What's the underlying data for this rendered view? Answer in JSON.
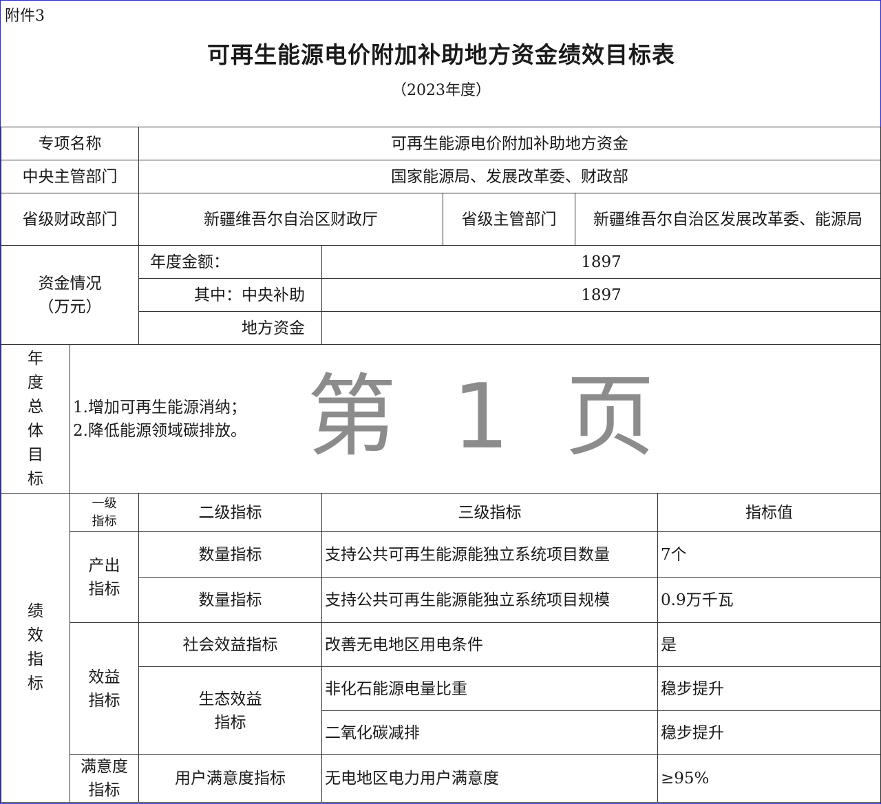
{
  "attachment_label": "附件3",
  "title": "可再生能源电价附加补助地方资金绩效目标表",
  "year": "（2023年度）",
  "rows": {
    "project_name_label": "专项名称",
    "project_name_value": "可再生能源电价附加补助地方资金",
    "central_dept_label": "中央主管部门",
    "central_dept_value": "国家能源局、发展改革委、财政部",
    "prov_finance_label": "省级财政部门",
    "prov_finance_value": "新疆维吾尔自治区财政厅",
    "prov_dept_label": "省级主管部门",
    "prov_dept_value": "新疆维吾尔自治区发展改革委、能源局"
  },
  "funds": {
    "label_line1": "资金情况",
    "label_line2": "（万元）",
    "annual_label": "年度金额：",
    "annual_value": "1897",
    "central_label": "其中：中央补助",
    "central_value": "1897",
    "local_label": "地方资金",
    "local_value": ""
  },
  "goals": {
    "label_chars": [
      "年",
      "度",
      "总",
      "体",
      "目",
      "标"
    ],
    "items": [
      "1.增加可再生能源消纳；",
      "2.降低能源领域碳排放。"
    ]
  },
  "watermark": "第 1 页",
  "performance": {
    "label_chars": [
      "绩",
      "效",
      "指",
      "标"
    ],
    "headers": {
      "level1_line1": "一级",
      "level1_line2": "指标",
      "level2": "二级指标",
      "level3": "三级指标",
      "value": "指标值"
    },
    "output_label": "产出指标",
    "benefit_label": "效益指标",
    "satisfaction_label_line1": "满意度",
    "satisfaction_label_line2": "指标",
    "rows": [
      {
        "level2": "数量指标",
        "level3": "支持公共可再生能源能独立系统项目数量",
        "value": "7个"
      },
      {
        "level2": "数量指标",
        "level3": "支持公共可再生能源能独立系统项目规模",
        "value": "0.9万千瓦"
      },
      {
        "level2": "社会效益指标",
        "level3": "改善无电地区用电条件",
        "value": "是"
      },
      {
        "level2_line1": "生态效益",
        "level2_line2": "指标",
        "level3": "非化石能源电量比重",
        "value": "稳步提升"
      },
      {
        "level3": "二氧化碳减排",
        "value": "稳步提升"
      },
      {
        "level2": "用户满意度指标",
        "level3": "无电地区电力用户满意度",
        "value": "≥95%"
      }
    ]
  }
}
